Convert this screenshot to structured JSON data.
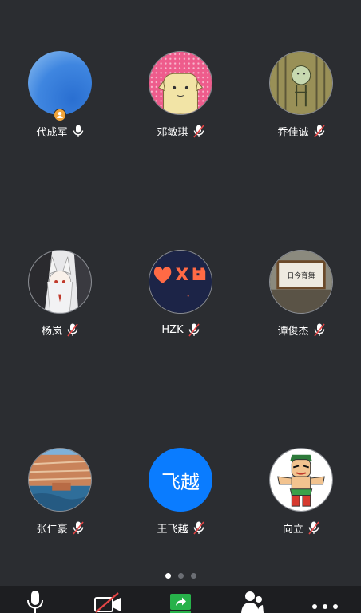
{
  "participants": [
    {
      "name": "代成军",
      "is_host": true,
      "muted": false
    },
    {
      "name": "邓敏琪",
      "is_host": false,
      "muted": true
    },
    {
      "name": "乔佳诚",
      "is_host": false,
      "muted": true
    },
    {
      "name": "杨岚",
      "is_host": false,
      "muted": true
    },
    {
      "name": "HZK",
      "is_host": false,
      "muted": true
    },
    {
      "name": "谭俊杰",
      "is_host": false,
      "muted": true
    },
    {
      "name": "张仁豪",
      "is_host": false,
      "muted": true
    },
    {
      "name": "王飞越",
      "is_host": false,
      "muted": true,
      "avatar_text": "飞越"
    },
    {
      "name": "向立",
      "is_host": false,
      "muted": true
    }
  ],
  "photo_texts": {
    "tan_avatar_sign": "日今育舞"
  },
  "pagination": {
    "pages": 3,
    "current": 1
  },
  "toolbar": {
    "items": [
      {
        "icon": "microphone-icon"
      },
      {
        "icon": "video-off-icon"
      },
      {
        "icon": "share-screen-icon"
      },
      {
        "icon": "participants-icon"
      },
      {
        "icon": "more-icon"
      }
    ]
  },
  "colors": {
    "background": "#2b2d31",
    "toolbar": "#1d1e21",
    "muted_red": "#e64545",
    "host_badge": "#f0a43a",
    "blue_avatar": "#0a7cff",
    "share_green": "#27b24a"
  }
}
